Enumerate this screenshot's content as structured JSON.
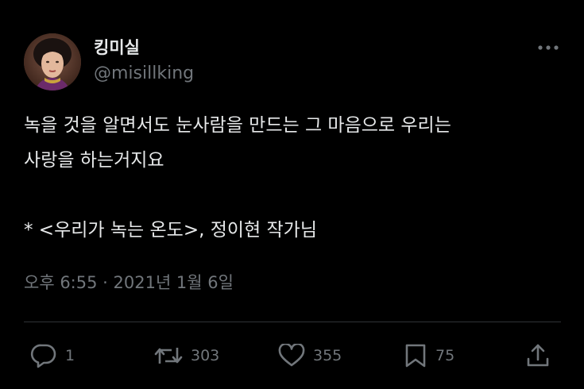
{
  "author": {
    "display_name": "킹미실",
    "handle": "@misillking"
  },
  "tweet": {
    "text": "녹을 것을 알면서도 눈사람을 만드는 그 마음으로 우리는\n사랑을 하는거지요\n\n* <우리가 녹는 온도>, 정이현 작가님",
    "timestamp": "오후 6:55 · 2021년 1월 6일"
  },
  "actions": {
    "reply": {
      "icon": "reply-icon",
      "count": "1"
    },
    "retweet": {
      "icon": "retweet-icon",
      "count": "303"
    },
    "like": {
      "icon": "heart-icon",
      "count": "355"
    },
    "bookmark": {
      "icon": "bookmark-icon",
      "count": "75"
    },
    "share": {
      "icon": "share-icon"
    }
  },
  "colors": {
    "background": "#000000",
    "text_primary": "#e7e9ea",
    "text_secondary": "#71767b",
    "divider": "#2f3336"
  }
}
